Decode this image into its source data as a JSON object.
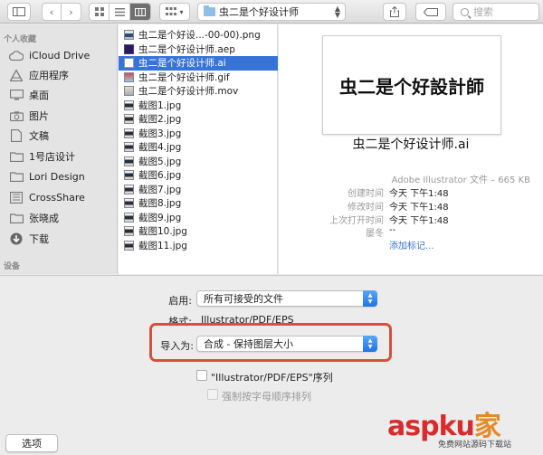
{
  "toolbar": {
    "view_icon_label": "",
    "path": "虫二是个好设计师",
    "search_placeholder": "搜索"
  },
  "sidebar": {
    "favorites_header": "个人收藏",
    "devices_header": "设备",
    "items": [
      {
        "label": "iCloud Drive",
        "icon": "cloud-icon"
      },
      {
        "label": "应用程序",
        "icon": "applications-icon"
      },
      {
        "label": "桌面",
        "icon": "desktop-icon"
      },
      {
        "label": "图片",
        "icon": "camera-icon"
      },
      {
        "label": "文稿",
        "icon": "documents-icon"
      },
      {
        "label": "1号店设计",
        "icon": "folder-icon"
      },
      {
        "label": "Lori Design",
        "icon": "folder-icon"
      },
      {
        "label": "CrossShare",
        "icon": "crossshare-icon"
      },
      {
        "label": "张晓成",
        "icon": "folder-icon"
      },
      {
        "label": "下载",
        "icon": "download-icon"
      }
    ]
  },
  "files": [
    {
      "name": "虫二是个好设...-00-00).png",
      "type": "png",
      "selected": false
    },
    {
      "name": "虫二是个好设计师.aep",
      "type": "aep",
      "selected": false
    },
    {
      "name": "虫二是个好设计师.ai",
      "type": "ai",
      "selected": true
    },
    {
      "name": "虫二是个好设计师.gif",
      "type": "gif",
      "selected": false
    },
    {
      "name": "虫二是个好设计师.mov",
      "type": "mov",
      "selected": false
    },
    {
      "name": "截图1.jpg",
      "type": "jpg",
      "selected": false
    },
    {
      "name": "截图2.jpg",
      "type": "jpg",
      "selected": false
    },
    {
      "name": "截图3.jpg",
      "type": "jpg",
      "selected": false
    },
    {
      "name": "截图4.jpg",
      "type": "jpg",
      "selected": false
    },
    {
      "name": "截图5.jpg",
      "type": "jpg",
      "selected": false
    },
    {
      "name": "截图6.jpg",
      "type": "jpg",
      "selected": false
    },
    {
      "name": "截图7.jpg",
      "type": "jpg",
      "selected": false
    },
    {
      "name": "截图8.jpg",
      "type": "jpg",
      "selected": false
    },
    {
      "name": "截图9.jpg",
      "type": "jpg",
      "selected": false
    },
    {
      "name": "截图10.jpg",
      "type": "jpg",
      "selected": false
    },
    {
      "name": "截图11.jpg",
      "type": "jpg",
      "selected": false
    }
  ],
  "preview": {
    "thumbnail_text": "虫二是个好設計師",
    "filename": "虫二是个好设计师.ai",
    "kind": "Adobe Illustrator 文件 – 665 KB",
    "meta": [
      {
        "label": "创建时间",
        "value": "今天 下午1:48"
      },
      {
        "label": "修改时间",
        "value": "今天 下午1:48"
      },
      {
        "label": "上次打开时间",
        "value": "今天 下午1:48"
      },
      {
        "label": "屡冬",
        "value": "--"
      },
      {
        "label": "",
        "value": "添加标记..."
      }
    ]
  },
  "options": {
    "enable_label": "启用:",
    "enable_value": "所有可接受的文件",
    "format_label": "格式:",
    "format_value": "Illustrator/PDF/EPS",
    "import_label": "导入为:",
    "import_value": "合成 - 保持图层大小",
    "checkbox1_label": "\"Illustrator/PDF/EPS\"序列",
    "checkbox2_label": "强制按字母顺序排列",
    "options_button": "选项"
  },
  "watermark": {
    "big": "aspku",
    "k": "家",
    "small": "免费网站源码下载站"
  },
  "colors": {
    "selection": "#3874d8",
    "highlight": "#d9503a",
    "link": "#3a75d6"
  }
}
